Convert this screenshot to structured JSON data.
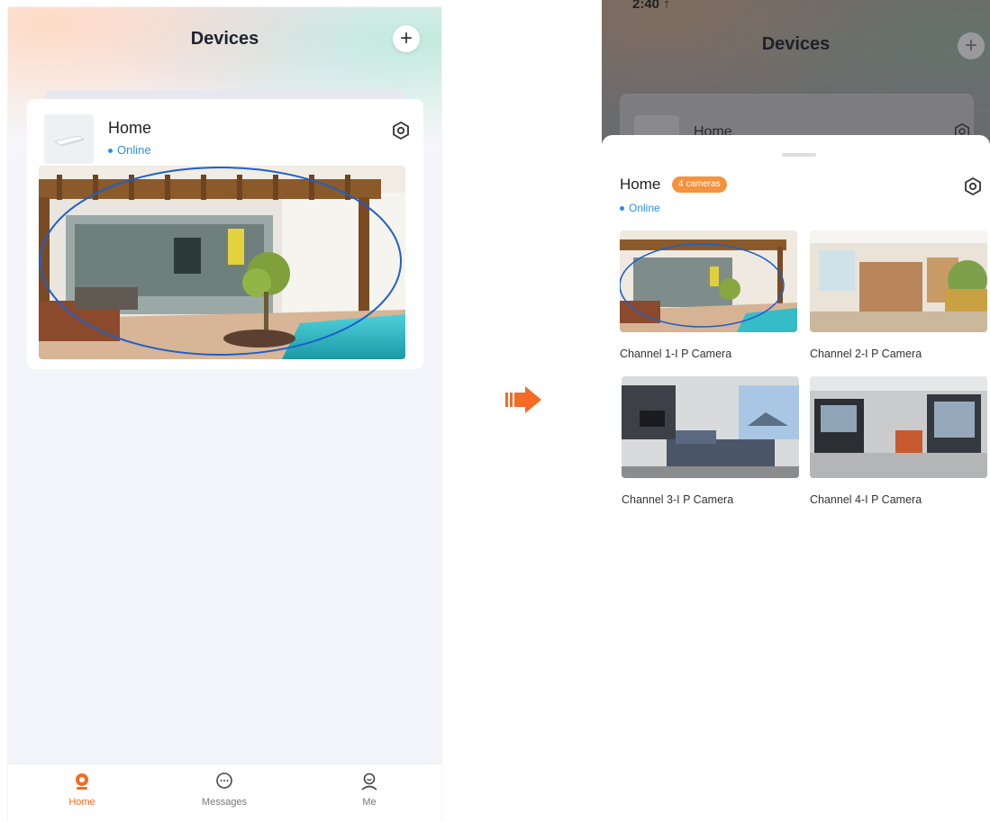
{
  "left": {
    "header": {
      "title": "Devices"
    },
    "device": {
      "name": "Home",
      "status": "Online"
    },
    "tabs": [
      {
        "label": "Home"
      },
      {
        "label": "Messages"
      },
      {
        "label": "Me"
      }
    ],
    "accent_color": "#f36b24",
    "highlight_color": "#1e5fc9"
  },
  "right": {
    "status_time": "2:40 ↑",
    "header": {
      "title": "Devices"
    },
    "back_device_name": "Home",
    "sheet": {
      "device_name": "Home",
      "badge": "4 cameras",
      "status": "Online",
      "cameras": [
        {
          "label": "Channel 1-I P  Camera"
        },
        {
          "label": "Channel 2-I P  Camera"
        },
        {
          "label": "Channel 3-I P  Camera"
        },
        {
          "label": "Channel 4-I P  Camera"
        }
      ]
    }
  }
}
